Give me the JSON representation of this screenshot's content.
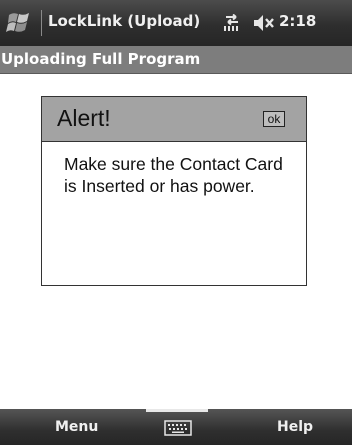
{
  "titlebar": {
    "start_icon": "windows-flag-icon",
    "title": "LockLink (Upload)",
    "connectivity_icon": "connectivity-arrows-icon",
    "volume_icon": "speaker-muted-icon",
    "time": "2:18"
  },
  "page_header": {
    "title": "Uploading Full Program"
  },
  "alert": {
    "title": "Alert!",
    "ok_label": "ok",
    "message": "Make sure the Contact Card is Inserted or has power."
  },
  "menubar": {
    "left_softkey": "Menu",
    "keyboard_icon": "keyboard-icon",
    "right_softkey": "Help"
  }
}
